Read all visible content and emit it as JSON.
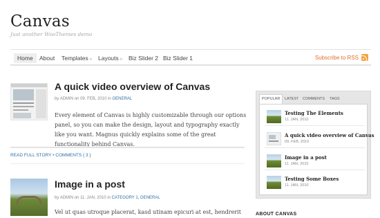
{
  "site": {
    "title": "Canvas",
    "tagline": "Just another WooThemes demo"
  },
  "nav": {
    "items": [
      {
        "label": "Home"
      },
      {
        "label": "About"
      },
      {
        "label": "Templates"
      },
      {
        "label": "Layouts"
      },
      {
        "label": "Biz Slider 2"
      },
      {
        "label": "Biz Slider 1"
      }
    ],
    "dropdown_caret": "»",
    "subscribe": "Subscribe to RSS"
  },
  "posts": [
    {
      "title": "A quick video overview of Canvas",
      "meta_author": "ADMIN",
      "meta_date": "09. FEB, 2010",
      "meta_cats": "GENERAL",
      "excerpt": "Every element of Canvas is highly customizable through our options panel, so you can make the design, layout and typography exactly like you want. Magnus quickly explains some of the great functionality behind Canvas.",
      "read_more": "READ FULL STORY",
      "comments": "COMMENTS { 3 }"
    },
    {
      "title": "Image in a post",
      "meta_author": "ADMIN",
      "meta_date": "11. JAN, 2010",
      "meta_cats": "CATEGORY 1, GENERAL",
      "excerpt": "Vel ut quas utroque placerat, kasd utinam epicuri at est, hendrerit"
    }
  ],
  "meta_words": {
    "by": "by",
    "on": "on",
    "in": "in"
  },
  "sidebar": {
    "tabs": [
      "POPULAR",
      "LATEST",
      "COMMENTS",
      "TAGS"
    ],
    "popular": [
      {
        "title": "Testing The Elements",
        "date": "11. JAN, 2010"
      },
      {
        "title": "A quick video overview of Canvas",
        "date": "09. FEB, 2010"
      },
      {
        "title": "Image in a post",
        "date": "11. JAN, 2010"
      },
      {
        "title": "Testing Some Boxes",
        "date": "11. JAN, 2010"
      }
    ],
    "next_widget_title": "ABOUT CANVAS"
  },
  "colors": {
    "link": "#2d6ea4",
    "rss": "#e0702a",
    "heading": "#222222"
  }
}
